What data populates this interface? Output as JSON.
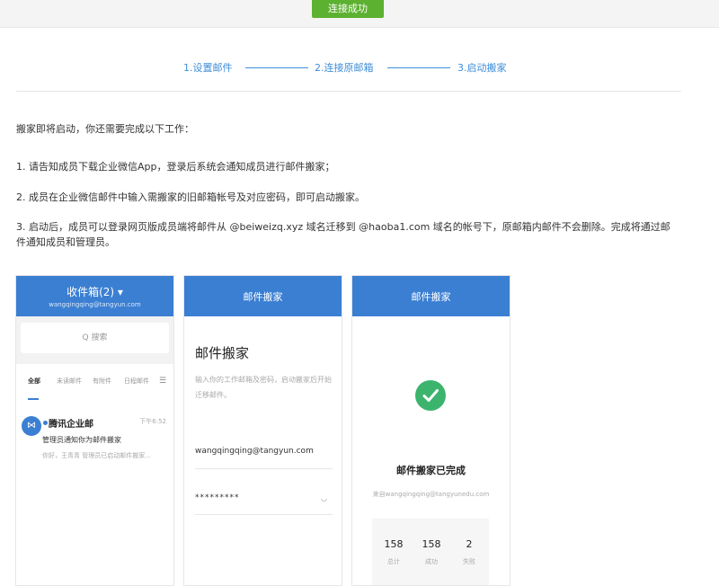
{
  "topbar": {
    "success_button": "连接成功"
  },
  "steps": {
    "step1": "1.设置邮件",
    "step2": "2.连接原邮箱",
    "step3": "3.启动搬家"
  },
  "intro": "搬家即将启动，你还需要完成以下工作：",
  "instructions": [
    "1. 请告知成员下载企业微信App，登录后系统会通知成员进行邮件搬家；",
    "2. 成员在企业微信邮件中输入需搬家的旧邮箱帐号及对应密码，即可启动搬家。",
    "3. 启动后，成员可以登录网页版成员端将邮件从 @beiweizq.xyz 域名迁移到 @haoba1.com 域名的帐号下，原邮箱内邮件不会删除。完成将通过邮件通知成员和管理员。"
  ],
  "phone1": {
    "title": "收件箱(2) ▾",
    "subtitle": "wangqingqing@tangyun.com",
    "search_placeholder": "Q 搜索",
    "tabs": [
      "全部",
      "未读邮件",
      "有附件",
      "日程邮件"
    ],
    "mail": {
      "sender": "腾讯企业邮",
      "time": "下午6:52",
      "subject": "管理员通知你为邮件搬家",
      "preview": "你好，王青青 管理员已启动邮件搬家..."
    }
  },
  "phone2": {
    "title": "邮件搬家",
    "heading": "邮件搬家",
    "description": "输入你的工作邮箱及密码，启动搬家后开始迁移邮件。",
    "email": "wangqingqing@tangyun.com",
    "password": "*********"
  },
  "phone3": {
    "title": "邮件搬家",
    "done_text": "邮件搬家已完成",
    "from_text": "来自wangqingqing@tangyunedu.com",
    "stats": [
      {
        "value": "158",
        "label": "总计"
      },
      {
        "value": "158",
        "label": "成功"
      },
      {
        "value": "2",
        "label": "失败"
      }
    ]
  },
  "colors": {
    "brand_blue": "#3b7fd3",
    "success_green": "#5db130",
    "check_green": "#3cb46e",
    "step_blue": "#3e8ed8"
  }
}
